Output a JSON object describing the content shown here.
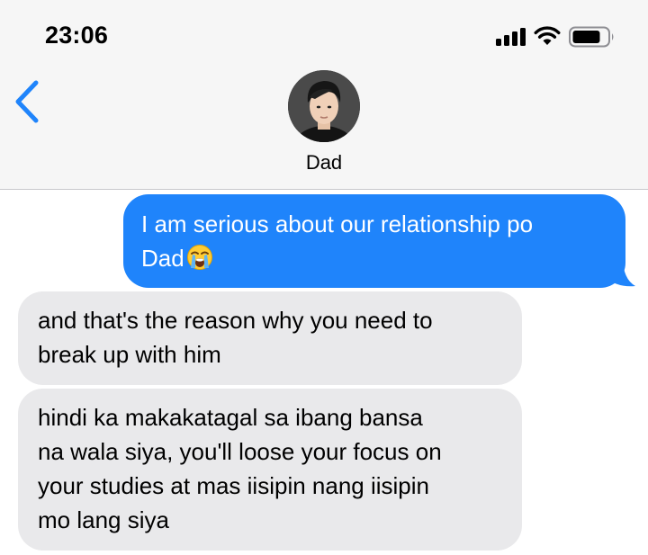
{
  "status_bar": {
    "time": "23:06",
    "icons": [
      "cellular-signal-icon",
      "wifi-icon",
      "battery-icon"
    ]
  },
  "nav": {
    "back_icon": "chevron-left-icon",
    "contact_name": "Dad",
    "avatar": "contact-photo"
  },
  "colors": {
    "sent_bubble": "#1f84fb",
    "received_bubble": "#e9e9eb",
    "accent": "#1f84fb",
    "header_bg": "#f6f6f6"
  },
  "messages": [
    {
      "direction": "sent",
      "text": "I am serious about our relationship po\nDad",
      "emoji": "loudly-crying-face"
    },
    {
      "direction": "received",
      "text": "and that's the reason why you need to\nbreak up with him"
    },
    {
      "direction": "received",
      "text": "hindi ka makakatagal sa ibang bansa\nna wala siya, you'll loose your focus on\nyour studies at mas iisipin nang iisipin\nmo lang siya"
    }
  ]
}
